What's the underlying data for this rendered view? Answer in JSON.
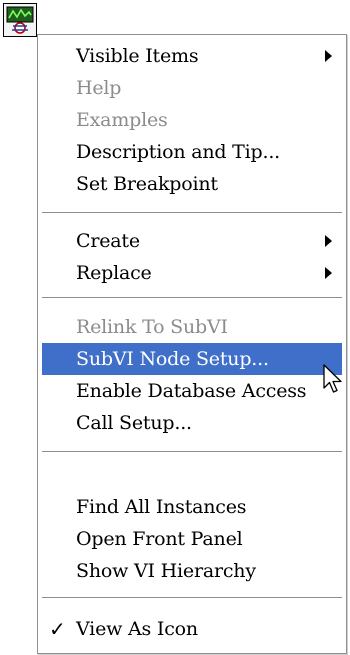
{
  "icon": {
    "name": "vi-waveform-icon"
  },
  "menu": {
    "groups": [
      [
        {
          "label": "Visible Items",
          "disabled": false,
          "submenu": true
        },
        {
          "label": "Help",
          "disabled": true
        },
        {
          "label": "Examples",
          "disabled": true
        },
        {
          "label": "Description and Tip...",
          "disabled": false
        },
        {
          "label": "Set Breakpoint",
          "disabled": false
        }
      ],
      [
        {
          "label": "Create",
          "disabled": false,
          "submenu": true
        },
        {
          "label": "Replace",
          "disabled": false,
          "submenu": true
        }
      ],
      [
        {
          "label": "Relink To SubVI",
          "disabled": true
        },
        {
          "label": "SubVI Node Setup...",
          "disabled": false,
          "selected": true
        },
        {
          "label": "Enable Database Access",
          "disabled": false
        },
        {
          "label": "Call Setup...",
          "disabled": false
        }
      ],
      [
        {
          "label": "Find All Instances",
          "disabled": false
        },
        {
          "label": "Open Front Panel",
          "disabled": false
        },
        {
          "label": "Show VI Hierarchy",
          "disabled": false
        }
      ],
      [
        {
          "label": "View As Icon",
          "disabled": false,
          "checked": true
        }
      ]
    ]
  },
  "colors": {
    "highlight": "#3f6fc8",
    "disabled_text": "#8c8c8c"
  }
}
